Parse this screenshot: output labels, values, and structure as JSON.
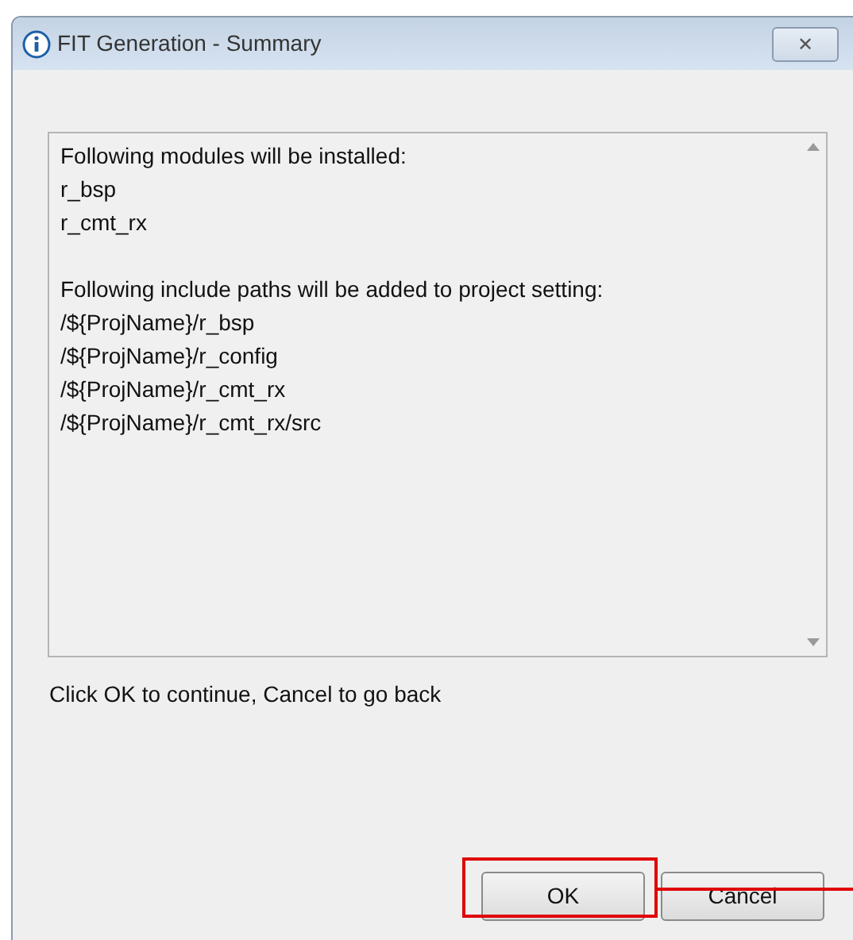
{
  "window": {
    "title": "FIT Generation - Summary",
    "close": "✕"
  },
  "summary": {
    "sections": [
      {
        "heading": "Following modules will be installed:",
        "items": [
          "r_bsp",
          "r_cmt_rx"
        ]
      },
      {
        "heading": "Following include paths will be added to project setting:",
        "items": [
          "/${ProjName}/r_bsp",
          "/${ProjName}/r_config",
          "/${ProjName}/r_cmt_rx",
          "/${ProjName}/r_cmt_rx/src"
        ]
      }
    ]
  },
  "hint": "Click OK to continue, Cancel to go back",
  "buttons": [
    {
      "label": "OK",
      "highlighted": true
    },
    {
      "label": "Cancel",
      "highlighted": false
    }
  ]
}
